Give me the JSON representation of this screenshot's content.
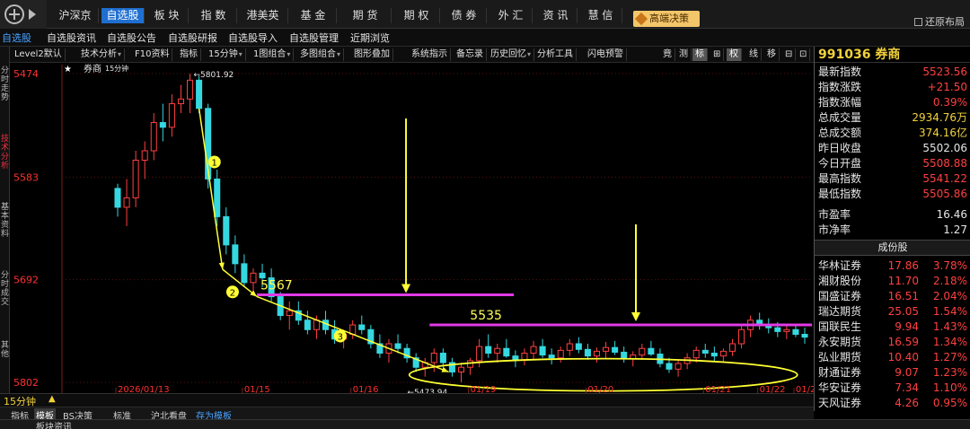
{
  "top_menu": {
    "items": [
      "沪深京",
      "自选股",
      "板 块",
      "指 数",
      "港美英",
      "基 金",
      "期 货",
      "期 权",
      "债 券",
      "外 汇",
      "资 讯",
      "慧 信"
    ],
    "active_index": 1,
    "premium_label": "高端决策",
    "restore_label": "还原布局"
  },
  "tab_bar": {
    "items": [
      "自选股",
      "自选股资讯",
      "自选股公告",
      "自选股研报",
      "自选股导入",
      "自选股管理",
      "近期浏览"
    ]
  },
  "left_nav": {
    "items": [
      "分时走势",
      "技术分析",
      "基本资料",
      "分时成交",
      "其他"
    ],
    "active_index": 1
  },
  "chart_toolbar": {
    "items": [
      "Level2默认",
      "技术分析",
      "F10资料",
      "指标",
      "15分钟",
      "1图组合",
      "多图组合",
      "图形叠加",
      "系统指示",
      "备忘录",
      "历史回忆",
      "分析工具",
      "闪电预警",
      "竟",
      "测",
      "标",
      "⊞",
      "权",
      "线",
      "移",
      "⊟",
      "⊡",
      "⊙"
    ],
    "dropdown": [
      1,
      4,
      5,
      6,
      10
    ],
    "highlight": [
      15,
      17
    ]
  },
  "chart": {
    "header": "券商",
    "header_period": "15分钟",
    "period_label": "15分钟",
    "y_ticks": [
      "5802",
      "5692",
      "5583",
      "5474"
    ],
    "date_ticks": [
      "2026/01/13",
      "01/15",
      "01/16",
      "01/19",
      "01/20",
      "01/21",
      "01/22",
      "01/23"
    ],
    "high_label": "5801.92",
    "low_label": "5473.94",
    "level_1_label": "5567",
    "level_2_label": "5535",
    "markers": [
      "1",
      "2",
      "3"
    ]
  },
  "chart_data": {
    "type": "candlestick",
    "y_range": [
      5474,
      5802
    ],
    "y_ticks": [
      5474,
      5583,
      5692,
      5802
    ],
    "resistance_levels": [
      5567,
      5535
    ],
    "high": 5801.92,
    "low": 5473.94,
    "candles": [
      [
        5680,
        5685,
        5650,
        5660
      ],
      [
        5660,
        5690,
        5640,
        5670
      ],
      [
        5670,
        5720,
        5660,
        5710
      ],
      [
        5710,
        5730,
        5690,
        5720
      ],
      [
        5720,
        5760,
        5710,
        5750
      ],
      [
        5750,
        5770,
        5730,
        5745
      ],
      [
        5745,
        5780,
        5735,
        5770
      ],
      [
        5770,
        5790,
        5760,
        5775
      ],
      [
        5775,
        5802,
        5760,
        5795
      ],
      [
        5795,
        5800,
        5760,
        5765
      ],
      [
        5765,
        5770,
        5680,
        5690
      ],
      [
        5690,
        5700,
        5640,
        5650
      ],
      [
        5650,
        5660,
        5610,
        5620
      ],
      [
        5620,
        5630,
        5590,
        5600
      ],
      [
        5600,
        5610,
        5575,
        5580
      ],
      [
        5580,
        5595,
        5570,
        5590
      ],
      [
        5590,
        5600,
        5575,
        5585
      ],
      [
        5585,
        5595,
        5560,
        5565
      ],
      [
        5565,
        5570,
        5540,
        5545
      ],
      [
        5545,
        5560,
        5530,
        5550
      ],
      [
        5550,
        5560,
        5535,
        5540
      ],
      [
        5540,
        5550,
        5525,
        5530
      ],
      [
        5530,
        5545,
        5520,
        5540
      ],
      [
        5540,
        5550,
        5525,
        5530
      ],
      [
        5530,
        5540,
        5515,
        5520
      ],
      [
        5520,
        5530,
        5510,
        5525
      ],
      [
        5525,
        5540,
        5520,
        5535
      ],
      [
        5535,
        5545,
        5525,
        5530
      ],
      [
        5530,
        5535,
        5510,
        5515
      ],
      [
        5515,
        5525,
        5500,
        5505
      ],
      [
        5505,
        5520,
        5495,
        5515
      ],
      [
        5515,
        5525,
        5505,
        5510
      ],
      [
        5510,
        5515,
        5495,
        5500
      ],
      [
        5500,
        5505,
        5485,
        5490
      ],
      [
        5490,
        5500,
        5480,
        5495
      ],
      [
        5495,
        5510,
        5485,
        5505
      ],
      [
        5505,
        5510,
        5490,
        5495
      ],
      [
        5495,
        5500,
        5480,
        5485
      ],
      [
        5485,
        5495,
        5474,
        5490
      ],
      [
        5490,
        5500,
        5482,
        5497
      ],
      [
        5497,
        5520,
        5490,
        5512
      ],
      [
        5512,
        5525,
        5500,
        5505
      ],
      [
        5505,
        5515,
        5495,
        5510
      ],
      [
        5510,
        5520,
        5500,
        5502
      ],
      [
        5502,
        5508,
        5490,
        5498
      ],
      [
        5498,
        5510,
        5492,
        5505
      ],
      [
        5505,
        5518,
        5498,
        5512
      ],
      [
        5512,
        5520,
        5500,
        5503
      ],
      [
        5503,
        5510,
        5493,
        5500
      ],
      [
        5500,
        5512,
        5495,
        5508
      ],
      [
        5508,
        5520,
        5502,
        5515
      ],
      [
        5515,
        5522,
        5505,
        5509
      ],
      [
        5509,
        5515,
        5498,
        5502
      ],
      [
        5502,
        5511,
        5495,
        5507
      ],
      [
        5507,
        5517,
        5500,
        5511
      ],
      [
        5511,
        5518,
        5503,
        5506
      ],
      [
        5506,
        5512,
        5495,
        5499
      ],
      [
        5499,
        5507,
        5491,
        5503
      ],
      [
        5503,
        5515,
        5498,
        5510
      ],
      [
        5510,
        5518,
        5502,
        5504
      ],
      [
        5504,
        5510,
        5490,
        5494
      ],
      [
        5494,
        5500,
        5484,
        5488
      ],
      [
        5488,
        5498,
        5480,
        5494
      ],
      [
        5494,
        5505,
        5488,
        5500
      ],
      [
        5500,
        5512,
        5495,
        5508
      ],
      [
        5508,
        5515,
        5500,
        5505
      ],
      [
        5505,
        5512,
        5496,
        5502
      ],
      [
        5502,
        5510,
        5495,
        5507
      ],
      [
        5507,
        5520,
        5502,
        5515
      ],
      [
        5515,
        5535,
        5510,
        5530
      ],
      [
        5530,
        5545,
        5522,
        5540
      ],
      [
        5540,
        5548,
        5530,
        5535
      ],
      [
        5535,
        5542,
        5526,
        5532
      ],
      [
        5532,
        5538,
        5522,
        5528
      ],
      [
        5528,
        5535,
        5520,
        5530
      ],
      [
        5530,
        5536,
        5522,
        5525
      ],
      [
        5525,
        5532,
        5515,
        5522
      ]
    ]
  },
  "right_panel": {
    "title": "991036 券商",
    "quote": [
      {
        "label": "最新指数",
        "value": "5523.56",
        "color": "red"
      },
      {
        "label": "指数涨跌",
        "value": "+21.50",
        "color": "red"
      },
      {
        "label": "指数涨幅",
        "value": "0.39%",
        "color": "red"
      },
      {
        "label": "总成交量",
        "value": "2934.76万",
        "color": "yellow"
      },
      {
        "label": "总成交额",
        "value": "374.16亿",
        "color": "yellow"
      },
      {
        "label": "昨日收盘",
        "value": "5502.06",
        "color": "white"
      },
      {
        "label": "今日开盘",
        "value": "5508.88",
        "color": "red"
      },
      {
        "label": "最高指数",
        "value": "5541.22",
        "color": "red"
      },
      {
        "label": "最低指数",
        "value": "5505.86",
        "color": "red"
      },
      {
        "label": "市盈率",
        "value": "16.46",
        "color": "white"
      },
      {
        "label": "市净率",
        "value": "1.27",
        "color": "white"
      }
    ],
    "constituents_header": "成份股",
    "constituents": [
      {
        "name": "华林证券",
        "price": "17.86",
        "weight": "3.78%"
      },
      {
        "name": "湘财股份",
        "price": "11.70",
        "weight": "2.18%"
      },
      {
        "name": "国盛证券",
        "price": "16.51",
        "weight": "2.04%"
      },
      {
        "name": "瑞达期货",
        "price": "25.05",
        "weight": "1.54%"
      },
      {
        "name": "国联民生",
        "price": "9.94",
        "weight": "1.43%"
      },
      {
        "name": "永安期货",
        "price": "16.59",
        "weight": "1.34%"
      },
      {
        "name": "弘业期货",
        "price": "10.40",
        "weight": "1.27%"
      },
      {
        "name": "财通证券",
        "price": "9.07",
        "weight": "1.23%"
      },
      {
        "name": "华安证券",
        "price": "7.34",
        "weight": "1.10%"
      },
      {
        "name": "天风证券",
        "price": "4.26",
        "weight": "0.95%"
      }
    ]
  },
  "bottom": {
    "bar1": [
      "指标",
      "模板",
      "BS决策",
      "标准",
      "沪北看盘",
      "存为模板"
    ],
    "bar1_selected": 1,
    "bar2": "板块资讯"
  },
  "colors": {
    "up": "#ff4040",
    "down": "#35d8e0",
    "level_line": "#e23ae6",
    "annotation": "#ffff33",
    "accent": "#1f6fd0"
  }
}
